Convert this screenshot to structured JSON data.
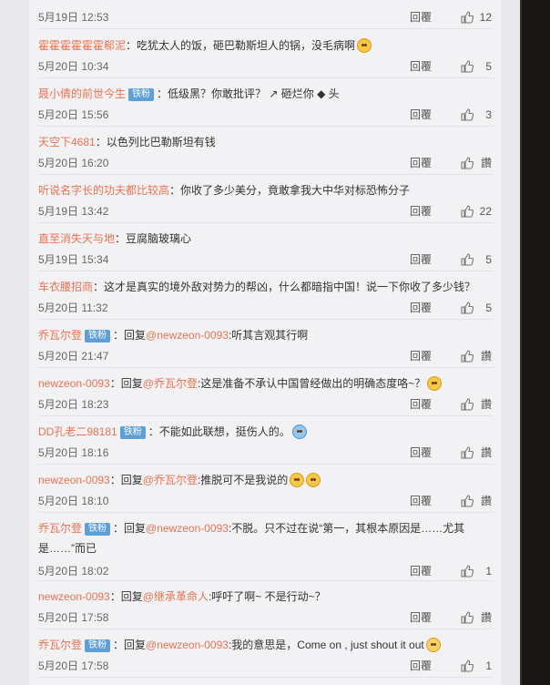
{
  "labels": {
    "reply": "回覆",
    "fan_badge": "铁粉",
    "reply_to": "回复"
  },
  "comments": [
    {
      "user": "",
      "badge": false,
      "text": "",
      "time": "5月19日 12:53",
      "likes": "12"
    },
    {
      "user": "霍霍霍霍霍霍郗泥",
      "badge": false,
      "text": "：吃犹太人的饭，砸巴勒斯坦人的锅，没毛病啊",
      "emoji": "doge",
      "time": "5月20日 10:34",
      "likes": "5"
    },
    {
      "user": "聂小倩的前世今生",
      "badge": true,
      "text": "：低级黑？你敢批评？ ↗ 砸烂你 ◆ 头",
      "time": "5月20日 15:56",
      "likes": "3"
    },
    {
      "user": "天空下4681",
      "badge": false,
      "text": "：以色列比巴勒斯坦有钱",
      "time": "5月20日 16:20",
      "likes": "讚"
    },
    {
      "user": "听说名字长的功夫都比较高",
      "badge": false,
      "text": "：你收了多少美分，竟敢拿我大中华对标恐怖分子",
      "time": "5月19日 13:42",
      "likes": "22"
    },
    {
      "user": "直至消失天与地",
      "badge": false,
      "text": "：豆腐脑玻璃心",
      "time": "5月19日 15:34",
      "likes": "5"
    },
    {
      "user": "车衣腰招商",
      "badge": false,
      "text": "：这才是真实的境外敌对势力的帮凶，什么都暗指中国！说一下你收了多少钱？",
      "time": "5月20日 11:32",
      "likes": "5"
    },
    {
      "user": "乔瓦尔登",
      "badge": true,
      "reply": true,
      "mention": "@newzeon-0093",
      "text": ":听其言观其行啊",
      "time": "5月20日 21:47",
      "likes": "讚"
    },
    {
      "user": "newzeon-0093",
      "badge": false,
      "reply": true,
      "mention": "@乔瓦尔登",
      "text": ":这是准备不承认中国曾经做出的明确态度咯~？",
      "emoji": "doge",
      "time": "5月20日 18:23",
      "likes": "讚"
    },
    {
      "user": "DD孔老二98181",
      "badge": true,
      "text": "：不能如此联想，挺伤人的。",
      "emoji": "cry",
      "time": "5月20日 18:16",
      "likes": "讚"
    },
    {
      "user": "newzeon-0093",
      "badge": false,
      "reply": true,
      "mention": "@乔瓦尔登",
      "text": ":推脱可不是我说的",
      "emoji": "doge2",
      "time": "5月20日 18:10",
      "likes": "讚"
    },
    {
      "user": "乔瓦尔登",
      "badge": true,
      "reply": true,
      "mention": "@newzeon-0093",
      "text": ":不脱。只不过在说“第一，其根本原因是……尤其",
      "text2": "是……”而已",
      "time": "5月20日 18:02",
      "likes": "1"
    },
    {
      "user": "newzeon-0093",
      "badge": false,
      "reply": true,
      "mention": "@继承革命人",
      "text": ":呼吁了啊~ 不是行动~？",
      "time": "5月20日 17:58",
      "likes": "讚"
    },
    {
      "user": "乔瓦尔登",
      "badge": true,
      "reply": true,
      "mention": "@newzeon-0093",
      "text": ":我的意思是，Come on , just shout it out",
      "emoji": "shy",
      "time": "5月20日 17:58",
      "likes": "1"
    }
  ]
}
